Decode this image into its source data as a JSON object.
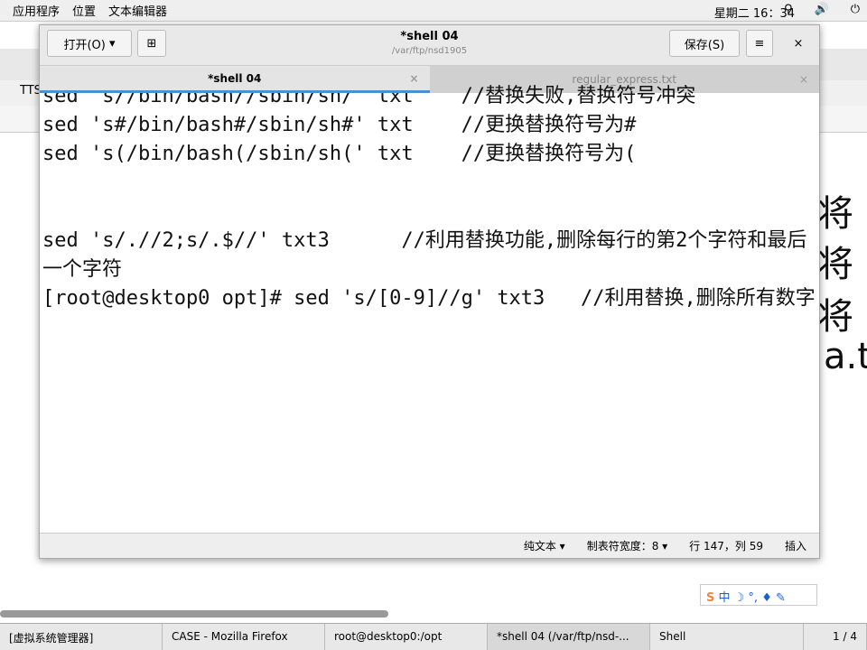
{
  "topbar": {
    "apps": "应用程序",
    "places": "位置",
    "editor": "文本编辑器",
    "clock": "星期二 16：34"
  },
  "background": {
    "tab_label": "TTS",
    "chars": [
      "将",
      "将",
      "将",
      "a.t"
    ]
  },
  "window": {
    "open_label": "打开(O)",
    "title": "*shell 04",
    "path": "/var/ftp/nsd1905",
    "save_label": "保存(S)",
    "tabs": [
      {
        "label": "*shell 04",
        "active": true
      },
      {
        "label": "regular_express.txt",
        "active": false
      }
    ],
    "lines": [
      "sed 's//bin/bash//sbin/sh/' txt    //替换失败,替换符号冲突",
      "sed 's#/bin/bash#/sbin/sh#' txt    //更换替换符号为#",
      "sed 's(/bin/bash(/sbin/sh(' txt    //更换替换符号为(",
      "",
      "",
      "sed 's/.//2;s/.$//' txt3      //利用替换功能,删除每行的第2个字符和最后一个字符",
      "[root@desktop0 opt]# sed 's/[0-9]//g' txt3   //利用替换,删除所有数字"
    ],
    "status": {
      "lang": "纯文本 ▾",
      "tab_width": "制表符宽度：8 ▾",
      "position": "行 147，列 59",
      "mode": "插入"
    }
  },
  "ime": {
    "label": "中 ☽ °, ♦ ✎"
  },
  "taskbar": {
    "items": [
      "[虚拟系统管理器]",
      "CASE - Mozilla Firefox",
      "root@desktop0:/opt",
      "*shell 04 (/var/ftp/nsd-...",
      "Shell"
    ],
    "workspace": "1 / 4"
  }
}
